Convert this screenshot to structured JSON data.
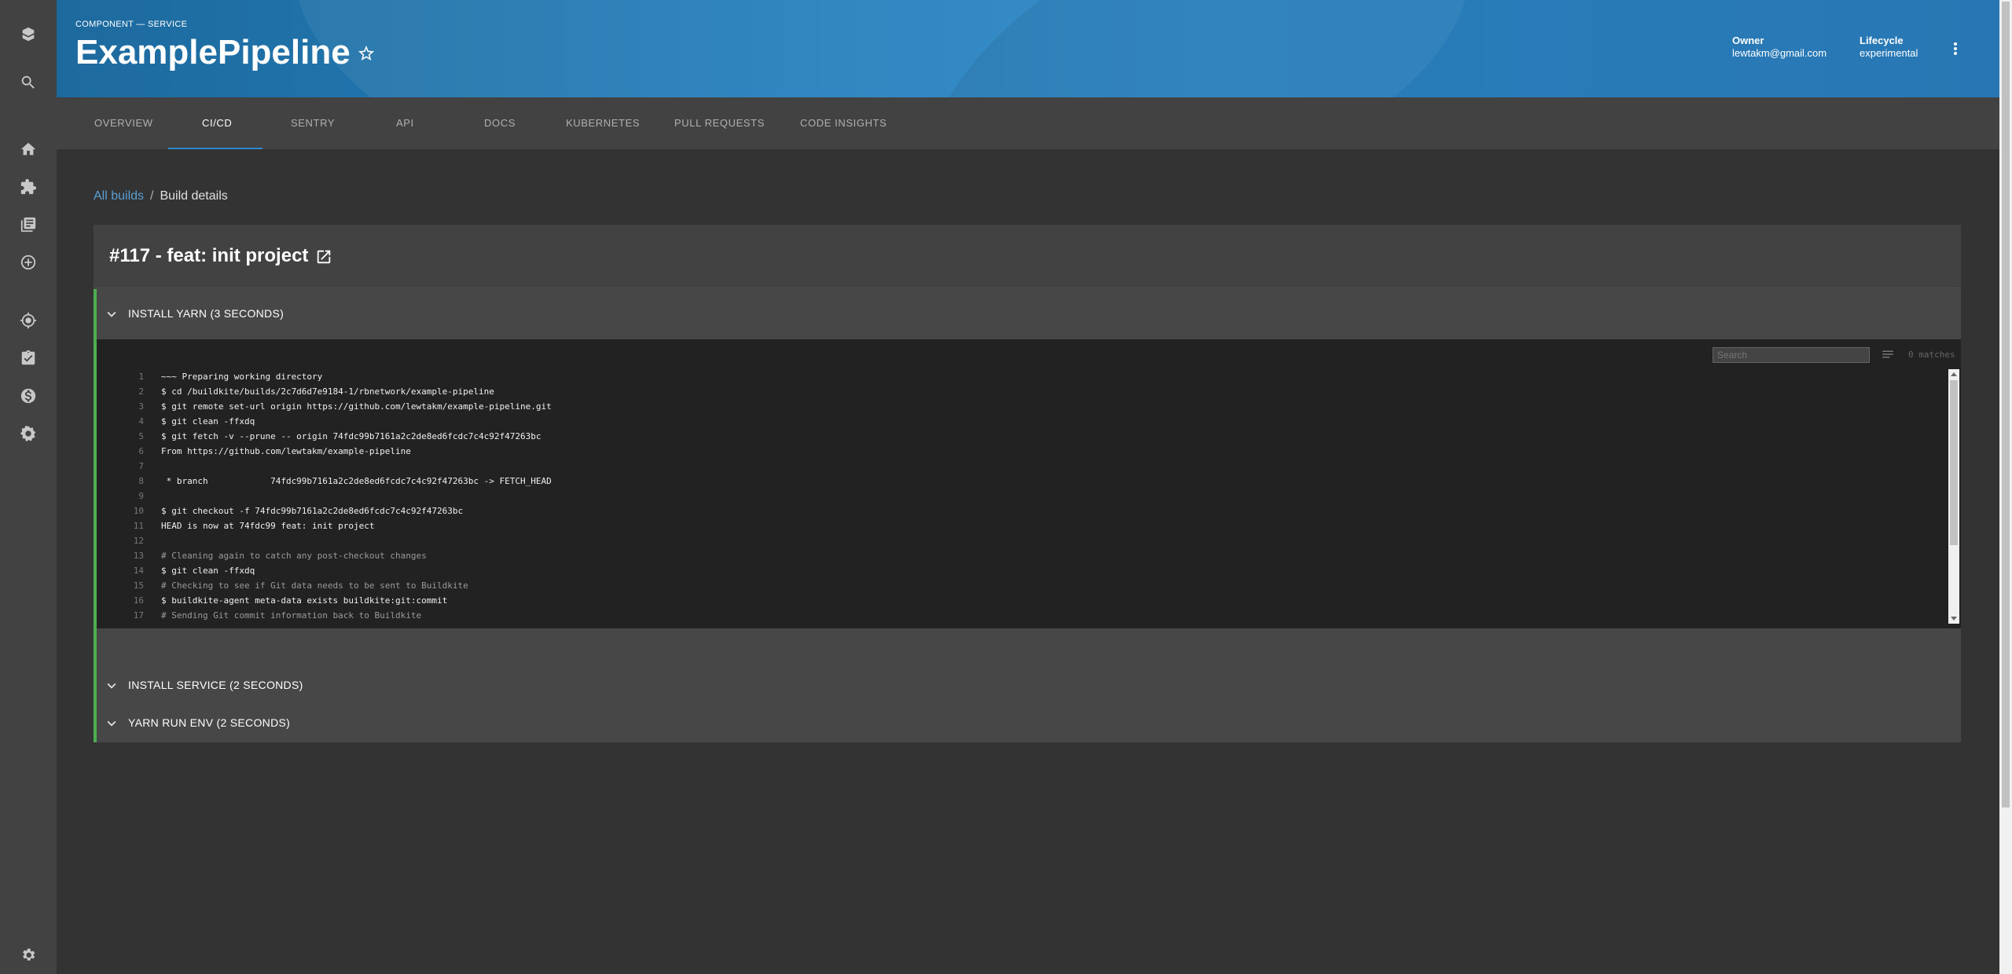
{
  "header": {
    "kind": "COMPONENT — SERVICE",
    "title": "ExamplePipeline",
    "owner_label": "Owner",
    "owner_value": "lewtakm@gmail.com",
    "lifecycle_label": "Lifecycle",
    "lifecycle_value": "experimental"
  },
  "sidebar": {
    "icons": [
      "backstage-logo-icon",
      "search-icon",
      "home-icon",
      "puzzle-icon",
      "library-icon",
      "add-icon",
      "radar-icon",
      "checklist-icon",
      "dollar-icon",
      "settings-cog-icon",
      "gear-icon"
    ]
  },
  "tabs": [
    {
      "label": "OVERVIEW",
      "active": false
    },
    {
      "label": "CI/CD",
      "active": true
    },
    {
      "label": "SENTRY",
      "active": false
    },
    {
      "label": "API",
      "active": false
    },
    {
      "label": "DOCS",
      "active": false
    },
    {
      "label": "KUBERNETES",
      "active": false
    },
    {
      "label": "PULL REQUESTS",
      "active": false
    },
    {
      "label": "CODE INSIGHTS",
      "active": false
    }
  ],
  "breadcrumb": {
    "link": "All builds",
    "separator": "/",
    "current": "Build details"
  },
  "build": {
    "title": "#117 - feat: init project"
  },
  "steps": [
    {
      "label": "INSTALL YARN (3 SECONDS)",
      "expanded": true
    },
    {
      "label": "INSTALL SERVICE (2 SECONDS)",
      "expanded": false
    },
    {
      "label": "YARN RUN ENV (2 SECONDS)",
      "expanded": false
    }
  ],
  "log": {
    "search_placeholder": "Search",
    "matches": "0 matches",
    "lines": [
      {
        "n": "1",
        "text": "~~~ Preparing working directory",
        "comment": false
      },
      {
        "n": "2",
        "text": "$ cd /buildkite/builds/2c7d6d7e9184-1/rbnetwork/example-pipeline",
        "comment": false
      },
      {
        "n": "3",
        "text": "$ git remote set-url origin https://github.com/lewtakm/example-pipeline.git",
        "comment": false
      },
      {
        "n": "4",
        "text": "$ git clean -ffxdq",
        "comment": false
      },
      {
        "n": "5",
        "text": "$ git fetch -v --prune -- origin 74fdc99b7161a2c2de8ed6fcdc7c4c92f47263bc",
        "comment": false
      },
      {
        "n": "6",
        "text": "From https://github.com/lewtakm/example-pipeline",
        "comment": false
      },
      {
        "n": "7",
        "text": "",
        "comment": false
      },
      {
        "n": "8",
        "text": " * branch            74fdc99b7161a2c2de8ed6fcdc7c4c92f47263bc -> FETCH_HEAD",
        "comment": false
      },
      {
        "n": "9",
        "text": "",
        "comment": false
      },
      {
        "n": "10",
        "text": "$ git checkout -f 74fdc99b7161a2c2de8ed6fcdc7c4c92f47263bc",
        "comment": false
      },
      {
        "n": "11",
        "text": "HEAD is now at 74fdc99 feat: init project",
        "comment": false
      },
      {
        "n": "12",
        "text": "",
        "comment": false
      },
      {
        "n": "13",
        "text": "# Cleaning again to catch any post-checkout changes",
        "comment": true
      },
      {
        "n": "14",
        "text": "$ git clean -ffxdq",
        "comment": false
      },
      {
        "n": "15",
        "text": "# Checking to see if Git data needs to be sent to Buildkite",
        "comment": true
      },
      {
        "n": "16",
        "text": "$ buildkite-agent meta-data exists buildkite:git:commit",
        "comment": false
      },
      {
        "n": "17",
        "text": "# Sending Git commit information back to Buildkite",
        "comment": true
      }
    ]
  }
}
